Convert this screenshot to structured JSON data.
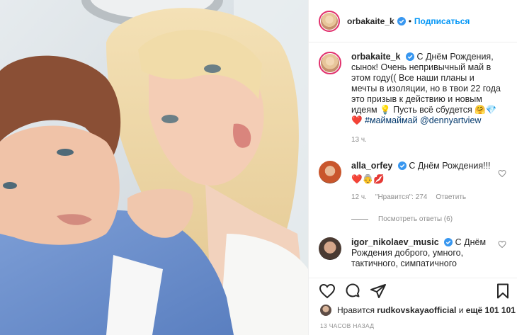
{
  "header": {
    "username": "orbakaite_k",
    "separator": "•",
    "follow_label": "Подписаться"
  },
  "caption": {
    "username": "orbakaite_k",
    "text_1": "С Днём Рождения, сынок! Очень непривычный май в этом году(( Все наши планы и мечты в изоляции, но в твои 22 года это призыв к действию и новым идеям ",
    "text_2": " Пусть всё сбудется ",
    "hashtag": "#маймаймай",
    "mention": "@dennyartview",
    "time": "13 ч."
  },
  "comments": [
    {
      "username": "alla_orfey",
      "text": "С Днём Рождения!!!",
      "emoji_line": "❤️👵💋",
      "time": "12 ч.",
      "likes": "\"Нравится\": 274",
      "reply_label": "Ответить",
      "view_replies": "Посмотреть ответы (6)"
    },
    {
      "username": "igor_nikolaev_music",
      "text": "С Днём Рождения доброго, умного, тактичного, симпатичного"
    }
  ],
  "likes": {
    "prefix": "Нравится",
    "user": "rudkovskayaofficial",
    "middle": "и",
    "others": "ещё 101 101"
  },
  "timestamp": "13 ЧАСОВ НАЗАД",
  "colors": {
    "accent": "#0095f6",
    "verified": "#3897f0",
    "heart": "#ed4956",
    "muted": "#8e8e8e"
  },
  "icons": [
    "verified-badge-icon",
    "heart-icon",
    "comment-icon",
    "share-icon",
    "bookmark-icon"
  ]
}
